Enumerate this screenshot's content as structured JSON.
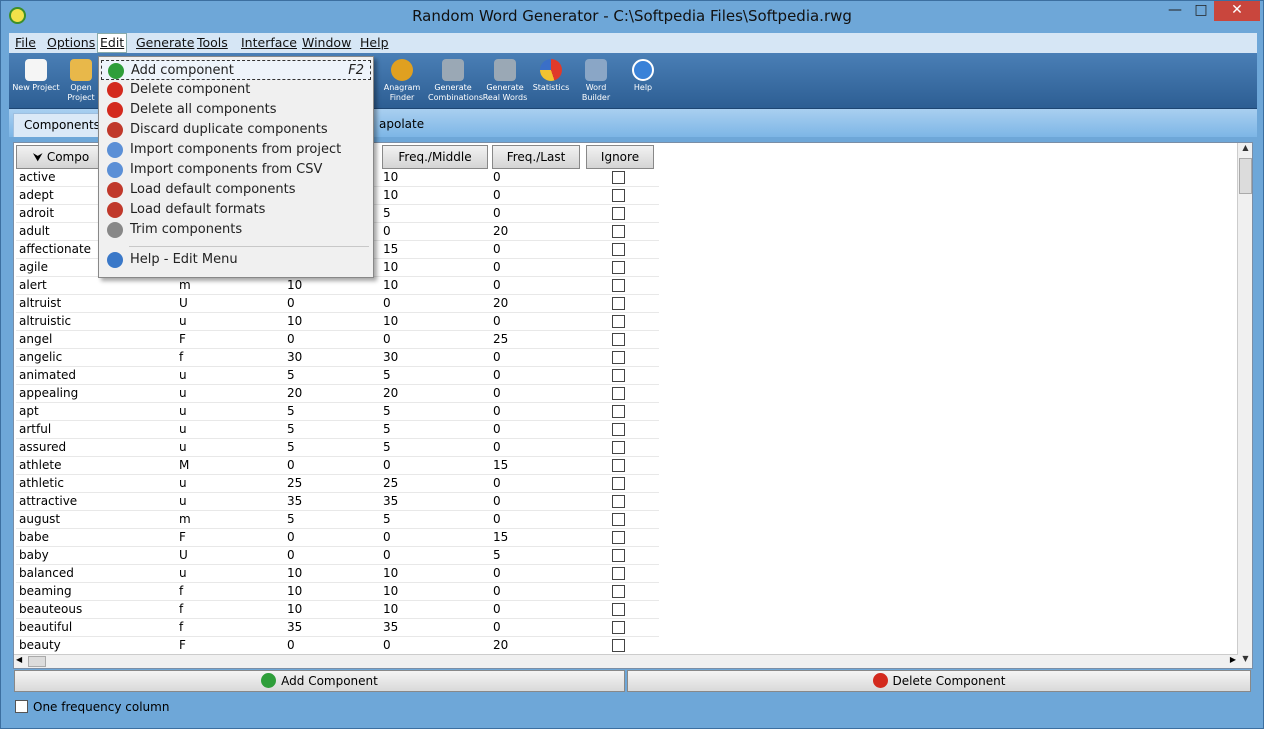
{
  "window": {
    "title": "Random Word Generator - C:\\Softpedia Files\\Softpedia.rwg",
    "minimize": "—",
    "maximize": "□",
    "close": "✕"
  },
  "menubar": [
    "File",
    "Options",
    "Edit",
    "Generate",
    "Tools",
    "Interface",
    "Window",
    "Help"
  ],
  "toolbar": [
    {
      "label": "New Project",
      "icon": "new-project-icon"
    },
    {
      "label": "Open Project",
      "icon": "open-project-icon"
    },
    {
      "label": "Anagram Finder",
      "icon": "anagram-icon"
    },
    {
      "label": "Generate Combinations",
      "icon": "combinations-icon"
    },
    {
      "label": "Generate Real Words",
      "icon": "real-words-icon"
    },
    {
      "label": "Statistics",
      "icon": "statistics-icon"
    },
    {
      "label": "Word Builder",
      "icon": "word-builder-icon"
    },
    {
      "label": "Help",
      "icon": "help-icon"
    }
  ],
  "tabs": {
    "components": "Components",
    "interpolate_partial": "apolate"
  },
  "table": {
    "headers": [
      "Compo",
      "Freq./Middle",
      "Freq./Last",
      "Ignore"
    ],
    "rows": [
      [
        "active",
        "",
        "",
        "10",
        "0"
      ],
      [
        "adept",
        "",
        "",
        "10",
        "0"
      ],
      [
        "adroit",
        "",
        "",
        "5",
        "0"
      ],
      [
        "adult",
        "",
        "",
        "0",
        "20"
      ],
      [
        "affectionate",
        "",
        "",
        "15",
        "0"
      ],
      [
        "agile",
        "",
        "",
        "10",
        "0"
      ],
      [
        "alert",
        "m",
        "10",
        "10",
        "0"
      ],
      [
        "altruist",
        "U",
        "0",
        "0",
        "20"
      ],
      [
        "altruistic",
        "u",
        "10",
        "10",
        "0"
      ],
      [
        "angel",
        "F",
        "0",
        "0",
        "25"
      ],
      [
        "angelic",
        "f",
        "30",
        "30",
        "0"
      ],
      [
        "animated",
        "u",
        "5",
        "5",
        "0"
      ],
      [
        "appealing",
        "u",
        "20",
        "20",
        "0"
      ],
      [
        "apt",
        "u",
        "5",
        "5",
        "0"
      ],
      [
        "artful",
        "u",
        "5",
        "5",
        "0"
      ],
      [
        "assured",
        "u",
        "5",
        "5",
        "0"
      ],
      [
        "athlete",
        "M",
        "0",
        "0",
        "15"
      ],
      [
        "athletic",
        "u",
        "25",
        "25",
        "0"
      ],
      [
        "attractive",
        "u",
        "35",
        "35",
        "0"
      ],
      [
        "august",
        "m",
        "5",
        "5",
        "0"
      ],
      [
        "babe",
        "F",
        "0",
        "0",
        "15"
      ],
      [
        "baby",
        "U",
        "0",
        "0",
        "5"
      ],
      [
        "balanced",
        "u",
        "10",
        "10",
        "0"
      ],
      [
        "beaming",
        "f",
        "10",
        "10",
        "0"
      ],
      [
        "beauteous",
        "f",
        "10",
        "10",
        "0"
      ],
      [
        "beautiful",
        "f",
        "35",
        "35",
        "0"
      ],
      [
        "beauty",
        "F",
        "0",
        "0",
        "20"
      ]
    ]
  },
  "buttons": {
    "add": "Add Component",
    "delete": "Delete Component"
  },
  "footer": {
    "one_freq": "One frequency column"
  },
  "edit_menu": {
    "items": [
      {
        "label": "Add component",
        "shortcut": "F2",
        "color": "#2e9e3a"
      },
      {
        "label": "Delete component",
        "shortcut": "",
        "color": "#d32a1e"
      },
      {
        "label": "Delete all components",
        "shortcut": "",
        "color": "#d32a1e"
      },
      {
        "label": "Discard duplicate components",
        "shortcut": "",
        "color": "#c0392b"
      },
      {
        "label": "Import components from project",
        "shortcut": "",
        "color": "#5b8fd6"
      },
      {
        "label": "Import components from CSV",
        "shortcut": "",
        "color": "#5b8fd6"
      },
      {
        "label": "Load default components",
        "shortcut": "",
        "color": "#c0392b"
      },
      {
        "label": "Load default formats",
        "shortcut": "",
        "color": "#c0392b"
      },
      {
        "label": "Trim components",
        "shortcut": "",
        "color": "#888888"
      },
      {
        "label": "Help - Edit Menu",
        "shortcut": "",
        "color": "#3a78c8"
      }
    ]
  }
}
